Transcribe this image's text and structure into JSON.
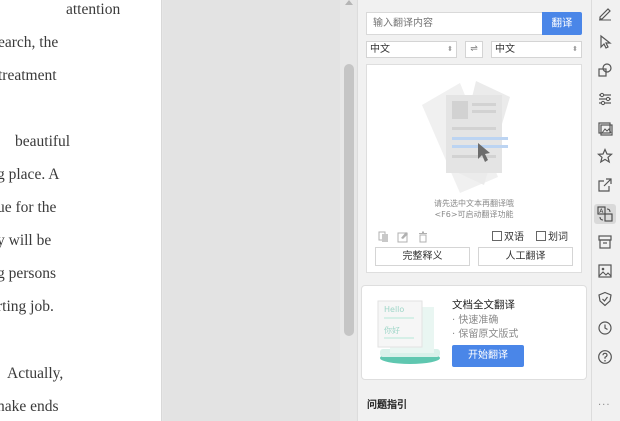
{
  "document": {
    "lines": [
      "attention",
      "earch, the",
      "treatment",
      "beautiful",
      "g place. A",
      "ue for the",
      "y will be",
      "g persons",
      "rting job.",
      "Actually,",
      "nake ends"
    ]
  },
  "translator": {
    "search_placeholder": "输入翻译内容",
    "translate_label": "翻译",
    "source_lang": "中文",
    "target_lang": "中文",
    "swap_symbol": "⇌",
    "hint_line1": "请先选中文本再翻译哦",
    "hint_line2": "<F6>可启动翻译功能",
    "bilingual_label": "双语",
    "word_select_label": "划词",
    "full_definition_label": "完整释义",
    "human_translation_label": "人工翻译"
  },
  "doc_translation": {
    "title": "文档全文翻译",
    "feature_1": "· 快速准确",
    "feature_2": "· 保留原文版式",
    "button_label": "开始翻译",
    "illustration_hello": "Hello",
    "illustration_nihao": "你好"
  },
  "help_title": "问题指引",
  "toolbar": {
    "icons": [
      "pen-icon",
      "cursor-icon",
      "shapes-icon",
      "settings-sliders-icon",
      "image-gallery-icon",
      "star-icon",
      "share-icon",
      "translate-icon",
      "archive-icon",
      "picture-icon",
      "shield-icon",
      "history-icon",
      "help-icon"
    ],
    "active_icon": "translate-icon",
    "more_symbol": "···"
  },
  "colors": {
    "accent": "#4a86e8",
    "panel_bg": "#f1f1f1",
    "workspace_bg": "#e3e3e3"
  }
}
